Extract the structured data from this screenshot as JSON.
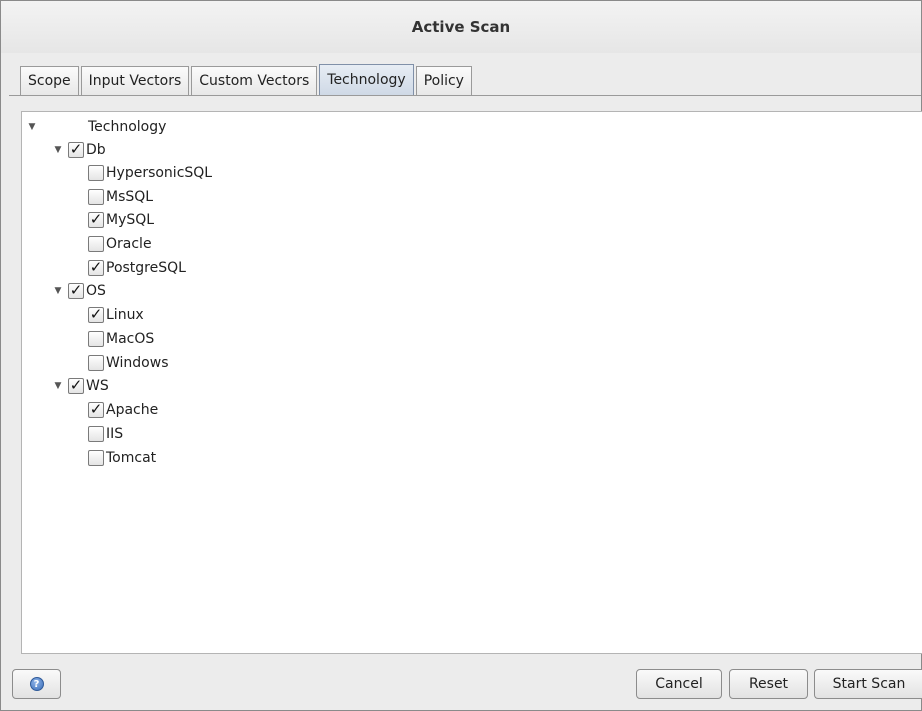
{
  "window": {
    "title": "Active Scan"
  },
  "tabs": [
    {
      "label": "Scope"
    },
    {
      "label": "Input Vectors"
    },
    {
      "label": "Custom Vectors"
    },
    {
      "label": "Technology"
    },
    {
      "label": "Policy"
    }
  ],
  "selected_tab": "Technology",
  "tree": {
    "root": {
      "label": "Technology",
      "expanded": true
    },
    "groups": [
      {
        "label": "Db",
        "checked": true,
        "expanded": true,
        "children": [
          {
            "label": "HypersonicSQL",
            "checked": false
          },
          {
            "label": "MsSQL",
            "checked": false
          },
          {
            "label": "MySQL",
            "checked": true
          },
          {
            "label": "Oracle",
            "checked": false
          },
          {
            "label": "PostgreSQL",
            "checked": true
          }
        ]
      },
      {
        "label": "OS",
        "checked": true,
        "expanded": true,
        "children": [
          {
            "label": "Linux",
            "checked": true
          },
          {
            "label": "MacOS",
            "checked": false
          },
          {
            "label": "Windows",
            "checked": false
          }
        ]
      },
      {
        "label": "WS",
        "checked": true,
        "expanded": true,
        "children": [
          {
            "label": "Apache",
            "checked": true
          },
          {
            "label": "IIS",
            "checked": false
          },
          {
            "label": "Tomcat",
            "checked": false
          }
        ]
      }
    ]
  },
  "footer": {
    "help_icon": "help-icon",
    "cancel_label": "Cancel",
    "reset_label": "Reset",
    "start_label": "Start Scan"
  }
}
